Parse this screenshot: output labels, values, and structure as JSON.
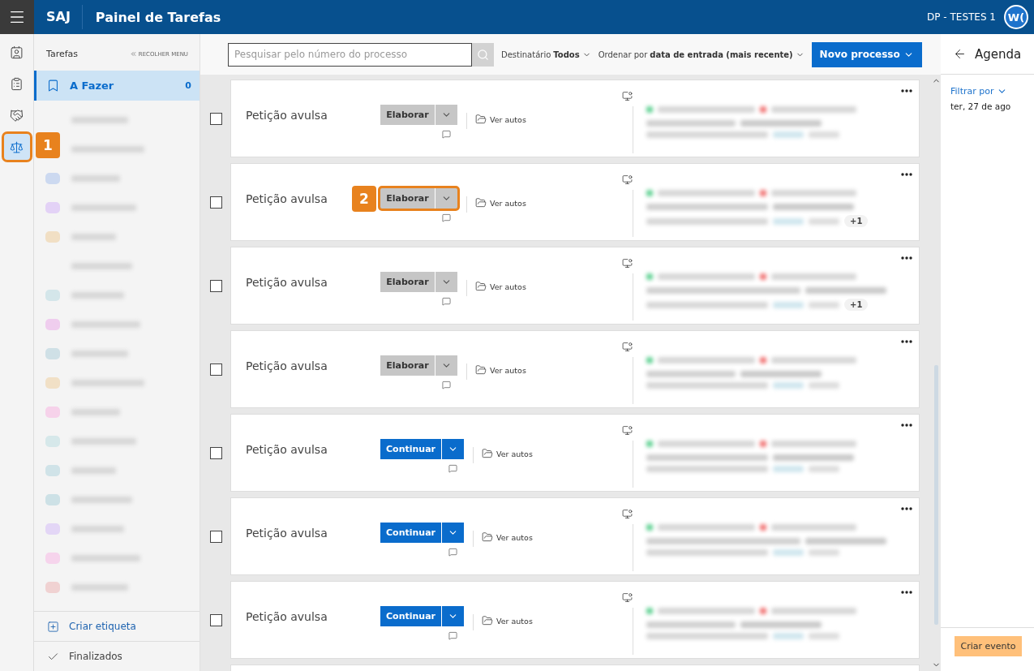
{
  "header": {
    "brand": "SAJ",
    "title": "Painel de Tarefas",
    "user": "DP - TESTES 1",
    "avatar": "W("
  },
  "rail": [
    {
      "selected": false
    },
    {
      "selected": false
    },
    {
      "selected": false
    },
    {
      "selected": true,
      "callout": "1"
    }
  ],
  "sidebar": {
    "title": "Tarefas",
    "collapse": "RECOLHER MENU",
    "items": [
      {
        "label": "A Fazer",
        "count": "0",
        "selected": true
      }
    ],
    "redacted_items": [
      {
        "kind": "plain"
      },
      {
        "kind": "plain"
      },
      {
        "kind": "tagged",
        "color": "#ccd9f0"
      },
      {
        "kind": "tagged",
        "color": "#e3d2f6"
      },
      {
        "kind": "tagged",
        "color": "#f1dfc4"
      },
      {
        "kind": "plain"
      },
      {
        "kind": "tagged",
        "color": "#d4e6ea"
      },
      {
        "kind": "tagged",
        "color": "#efcdee"
      },
      {
        "kind": "tagged",
        "color": "#cfe0e6"
      },
      {
        "kind": "tagged",
        "color": "#f1e0c6"
      },
      {
        "kind": "tagged",
        "color": "#f6d2ea"
      },
      {
        "kind": "tagged",
        "color": "#d6e8ea"
      },
      {
        "kind": "tagged",
        "color": "#d0e3e8"
      },
      {
        "kind": "tagged",
        "color": "#cde1e6"
      },
      {
        "kind": "tagged",
        "color": "#e3d6f6"
      },
      {
        "kind": "tagged",
        "color": "#f6d4ec"
      },
      {
        "kind": "tagged",
        "color": "#f0d2d2"
      }
    ],
    "create_label": "Criar etiqueta",
    "finished": "Finalizados"
  },
  "toolbar": {
    "search_placeholder": "Pesquisar pelo número do processo",
    "recipient_label": "Destinatário",
    "recipient_value": "Todos",
    "order_label": "Ordenar por",
    "order_value": "data de entrada (mais recente)",
    "new_button": "Novo processo"
  },
  "tasks": [
    {
      "title": "Petição avulsa",
      "action": {
        "label": "Elaborar",
        "kind": "draft"
      },
      "link": "Ver autos",
      "checked": false
    },
    {
      "title": "Petição avulsa",
      "action": {
        "label": "Elaborar",
        "kind": "draft"
      },
      "link": "Ver autos",
      "checked": false,
      "extra": "+1",
      "callout": "2"
    },
    {
      "title": "Petição avulsa",
      "action": {
        "label": "Elaborar",
        "kind": "draft"
      },
      "link": "Ver autos",
      "checked": false,
      "extra": "+1"
    },
    {
      "title": "Petição avulsa",
      "action": {
        "label": "Elaborar",
        "kind": "draft"
      },
      "link": "Ver autos",
      "checked": false
    },
    {
      "title": "Petição avulsa",
      "action": {
        "label": "Continuar",
        "kind": "continue"
      },
      "link": "Ver autos",
      "checked": false
    },
    {
      "title": "Petição avulsa",
      "action": {
        "label": "Continuar",
        "kind": "continue"
      },
      "link": "Ver autos",
      "checked": false
    },
    {
      "title": "Petição avulsa",
      "action": {
        "label": "Continuar",
        "kind": "continue"
      },
      "link": "Ver autos",
      "checked": false
    }
  ],
  "agenda": {
    "title": "Agenda",
    "filter": "Filtrar por",
    "date": "ter, 27 de ago",
    "create_button": "Criar evento"
  }
}
